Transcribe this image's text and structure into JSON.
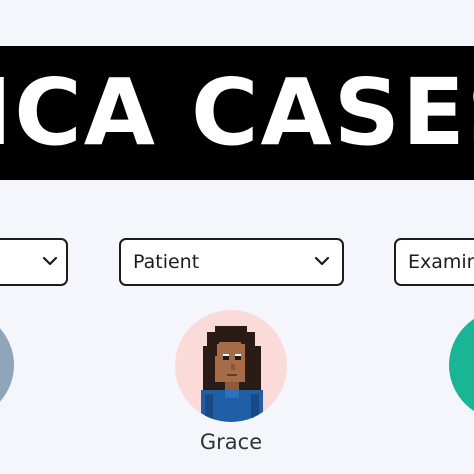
{
  "title": {
    "text": "ICA CASES"
  },
  "filters": {
    "left": {
      "label": ""
    },
    "middle": {
      "label": "Patient"
    },
    "right": {
      "label": "Examin"
    }
  },
  "patients": [
    {
      "name": ""
    },
    {
      "name": "Grace"
    },
    {
      "name": ""
    }
  ],
  "colors": {
    "background": "#f4f6fb",
    "banner": "#000000",
    "banner_text": "#ffffff",
    "avatar_left": "#8fa5ba",
    "avatar_mid": "#fbdada",
    "avatar_right": "#19b595"
  },
  "icons": {
    "dropdown": "chevron-down-icon",
    "avatar": "pixel-art-woman-avatar"
  }
}
